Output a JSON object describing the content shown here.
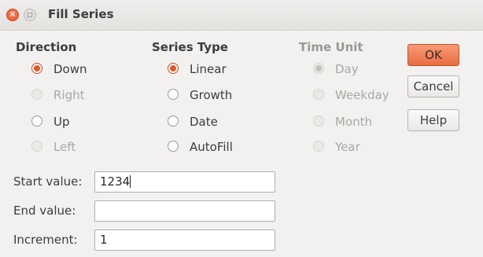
{
  "window": {
    "title": "Fill Series"
  },
  "direction": {
    "header": "Direction",
    "options": [
      {
        "label": "Down",
        "selected": true,
        "enabled": true
      },
      {
        "label": "Right",
        "selected": false,
        "enabled": false
      },
      {
        "label": "Up",
        "selected": false,
        "enabled": true
      },
      {
        "label": "Left",
        "selected": false,
        "enabled": false
      }
    ]
  },
  "series_type": {
    "header": "Series Type",
    "options": [
      {
        "label": "Linear",
        "selected": true,
        "enabled": true
      },
      {
        "label": "Growth",
        "selected": false,
        "enabled": true
      },
      {
        "label": "Date",
        "selected": false,
        "enabled": true
      },
      {
        "label": "AutoFill",
        "selected": false,
        "enabled": true
      }
    ]
  },
  "time_unit": {
    "header": "Time Unit",
    "enabled": false,
    "options": [
      {
        "label": "Day",
        "selected": true,
        "enabled": false
      },
      {
        "label": "Weekday",
        "selected": false,
        "enabled": false
      },
      {
        "label": "Month",
        "selected": false,
        "enabled": false
      },
      {
        "label": "Year",
        "selected": false,
        "enabled": false
      }
    ]
  },
  "buttons": {
    "ok": "OK",
    "cancel": "Cancel",
    "help": "Help"
  },
  "fields": {
    "start": {
      "label": "Start value:",
      "value": "1234"
    },
    "end": {
      "label": "End value:",
      "value": ""
    },
    "increment": {
      "label": "Increment:",
      "value": "1"
    }
  },
  "colors": {
    "accent": "#e2562a",
    "ok_button": "#ec774c",
    "background": "#f2f1f0"
  }
}
